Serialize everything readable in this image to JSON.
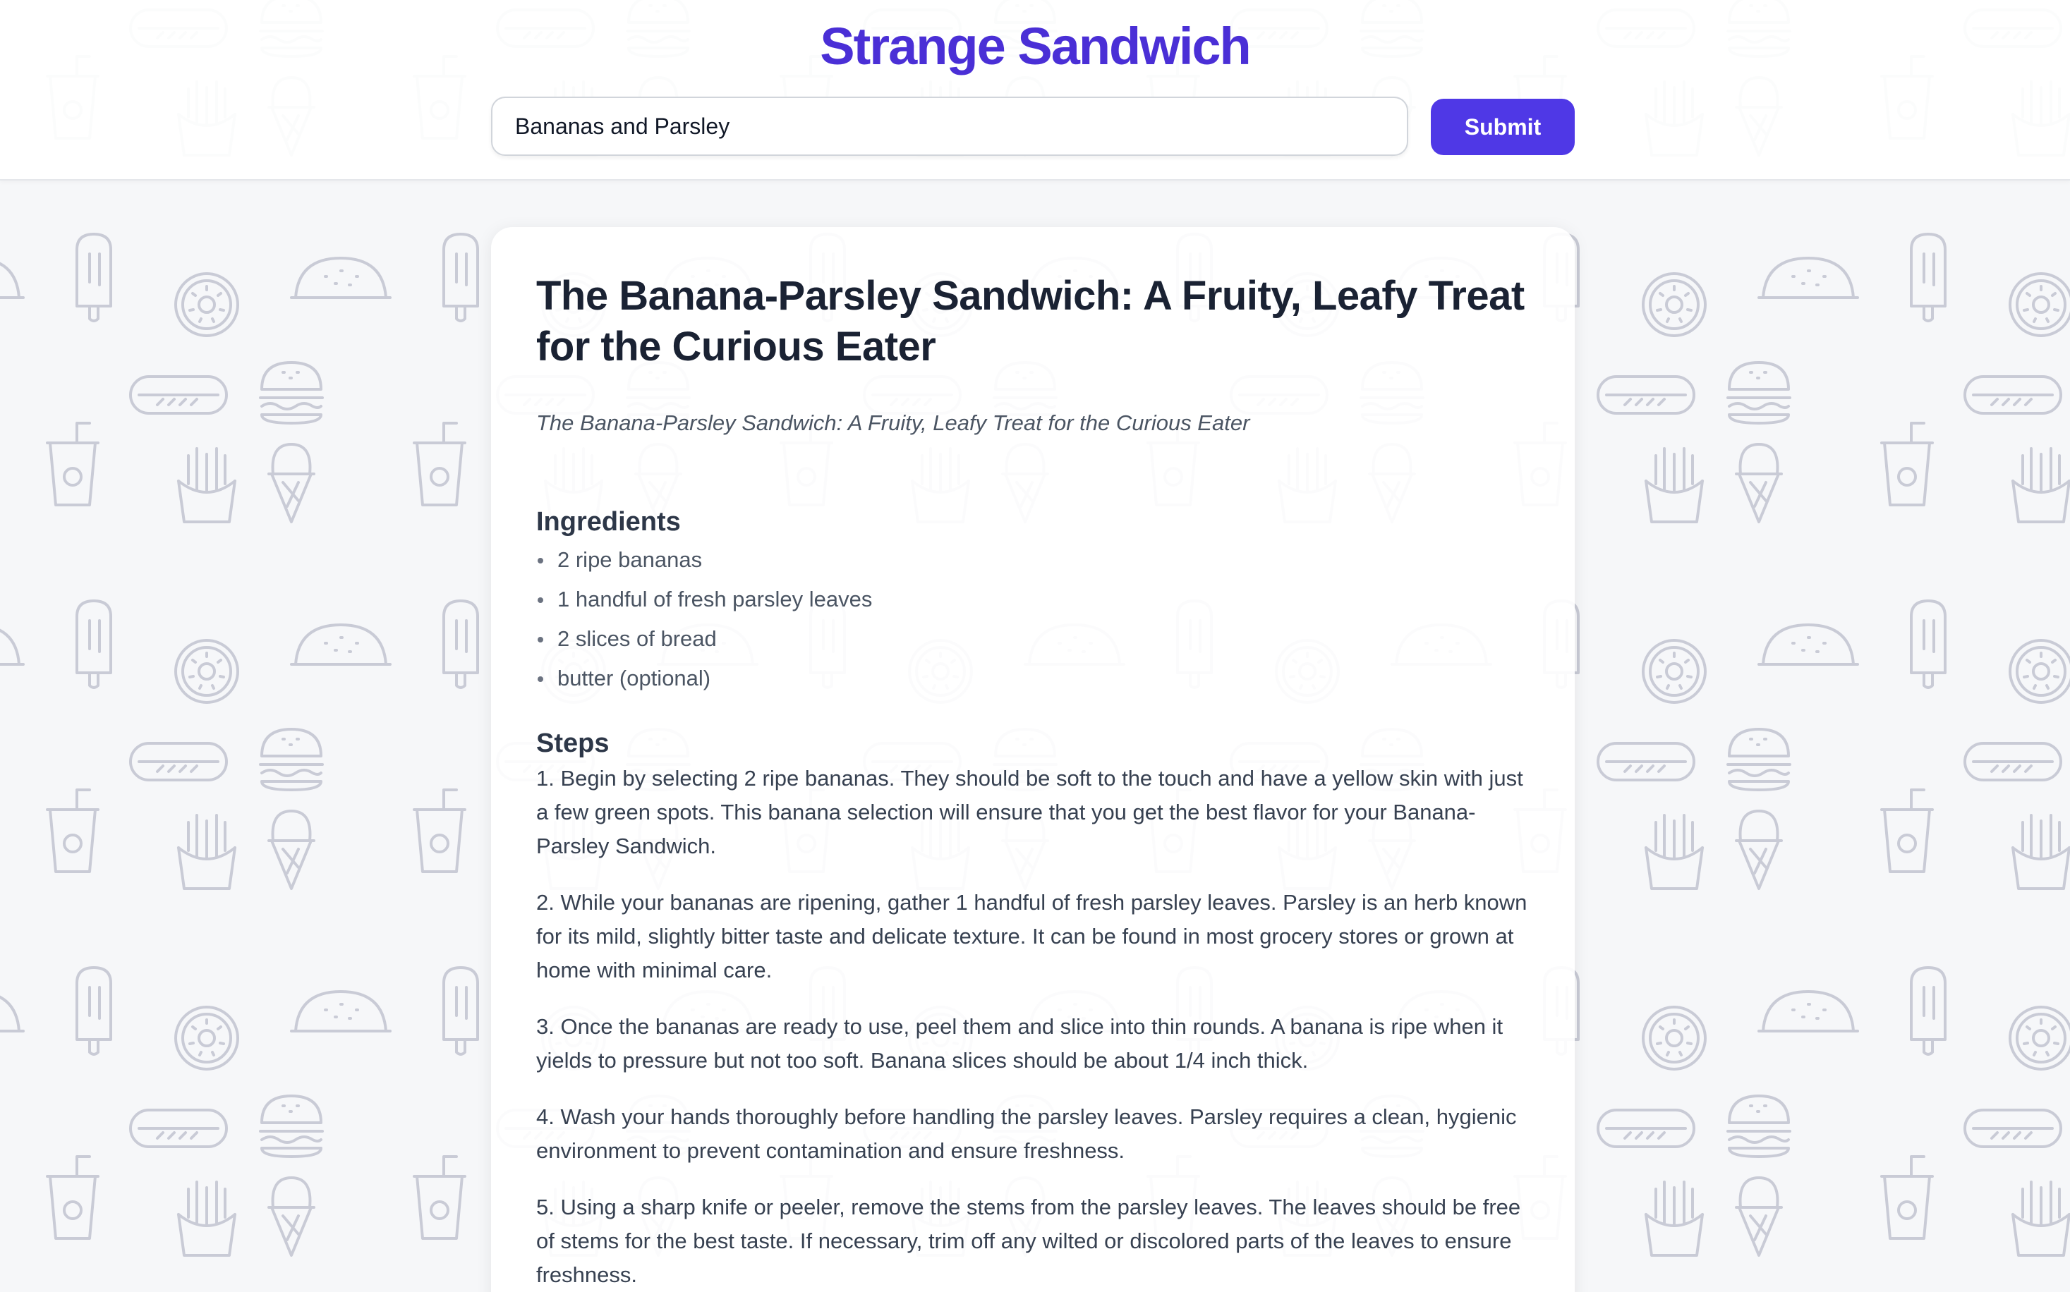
{
  "app": {
    "title": "Strange Sandwich"
  },
  "search": {
    "value": "Bananas and Parsley",
    "submit_label": "Submit"
  },
  "recipe": {
    "title": "The Banana-Parsley Sandwich: A Fruity, Leafy Treat for the Curious Eater",
    "subtitle": "The Banana-Parsley Sandwich: A Fruity, Leafy Treat for the Curious Eater",
    "ingredients_heading": "Ingredients",
    "ingredients": [
      "2 ripe bananas",
      "1 handful of fresh parsley leaves",
      "2 slices of bread",
      "butter (optional)"
    ],
    "steps_heading": "Steps",
    "steps": [
      "1. Begin by selecting 2 ripe bananas. They should be soft to the touch and have a yellow skin with just a few green spots. This banana selection will ensure that you get the best flavor for your Banana-Parsley Sandwich.",
      "2. While your bananas are ripening, gather 1 handful of fresh parsley leaves. Parsley is an herb known for its mild, slightly bitter taste and delicate texture. It can be found in most grocery stores or grown at home with minimal care.",
      "3. Once the bananas are ready to use, peel them and slice into thin rounds. A banana is ripe when it yields to pressure but not too soft. Banana slices should be about 1/4 inch thick.",
      "4. Wash your hands thoroughly before handling the parsley leaves. Parsley requires a clean, hygienic environment to prevent contamination and ensure freshness.",
      "5. Using a sharp knife or peeler, remove the stems from the parsley leaves. The leaves should be free of stems for the best taste. If necessary, trim off any wilted or discolored parts of the leaves to ensure freshness."
    ]
  },
  "colors": {
    "brand": "#4a2fd6",
    "button": "#4f38e6",
    "background": "#f6f7f9",
    "pattern_stroke": "#c9cbd6"
  },
  "background_icons": [
    "popsicle-icon",
    "donut-icon",
    "taco-icon",
    "hotdog-icon",
    "burger-icon",
    "soda-cup-icon",
    "fries-icon",
    "ice-cream-cone-icon"
  ]
}
